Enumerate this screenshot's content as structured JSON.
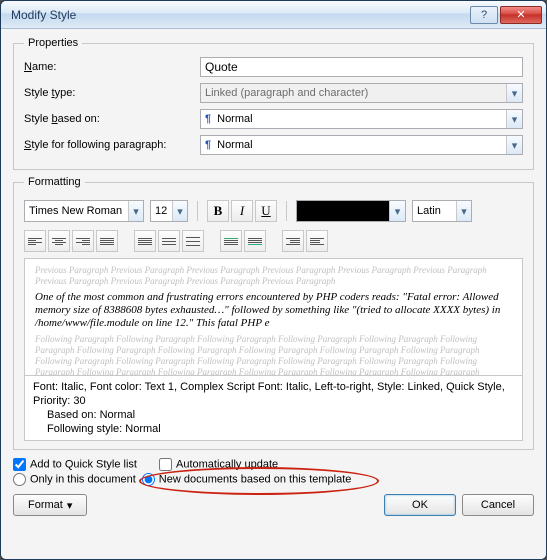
{
  "window": {
    "title": "Modify Style"
  },
  "properties": {
    "legend": "Properties",
    "name_label": "Name:",
    "name_value": "Quote",
    "type_label": "Style type:",
    "type_value": "Linked (paragraph and character)",
    "based_label": "Style based on:",
    "based_value": "Normal",
    "following_label": "Style for following paragraph:",
    "following_value": "Normal"
  },
  "formatting": {
    "legend": "Formatting",
    "font_name": "Times New Roman",
    "font_size": "12",
    "script": "Latin"
  },
  "preview": {
    "prev_para": "Previous Paragraph Previous Paragraph Previous Paragraph Previous Paragraph Previous Paragraph Previous Paragraph Previous Paragraph Previous Paragraph Previous Paragraph Previous Paragraph",
    "sample": "One of the most common and frustrating errors encountered by PHP coders reads: \"Fatal error: Allowed memory size of 8388608 bytes exhausted…\" followed by something like \"(tried to allocate XXXX bytes) in /home/www/file.module on line 12.\" This fatal PHP e",
    "follow_para": "Following Paragraph Following Paragraph Following Paragraph Following Paragraph Following Paragraph Following Paragraph Following Paragraph Following Paragraph Following Paragraph Following Paragraph Following Paragraph Following Paragraph Following Paragraph Following Paragraph Following Paragraph Following Paragraph Following Paragraph Following Paragraph Following Paragraph Following Paragraph Following Paragraph Following Paragraph Following Paragraph Following Paragraph Following Paragraph"
  },
  "description": {
    "line1": "Font: Italic, Font color: Text 1, Complex Script Font: Italic, Left-to-right, Style: Linked, Quick Style, Priority: 30",
    "line2": "Based on: Normal",
    "line3": "Following style: Normal"
  },
  "options": {
    "add_quick": "Add to Quick Style list",
    "auto_update": "Automatically update",
    "only_doc": "Only in this document",
    "new_docs": "New documents based on this template"
  },
  "footer": {
    "format": "Format",
    "ok": "OK",
    "cancel": "Cancel"
  }
}
